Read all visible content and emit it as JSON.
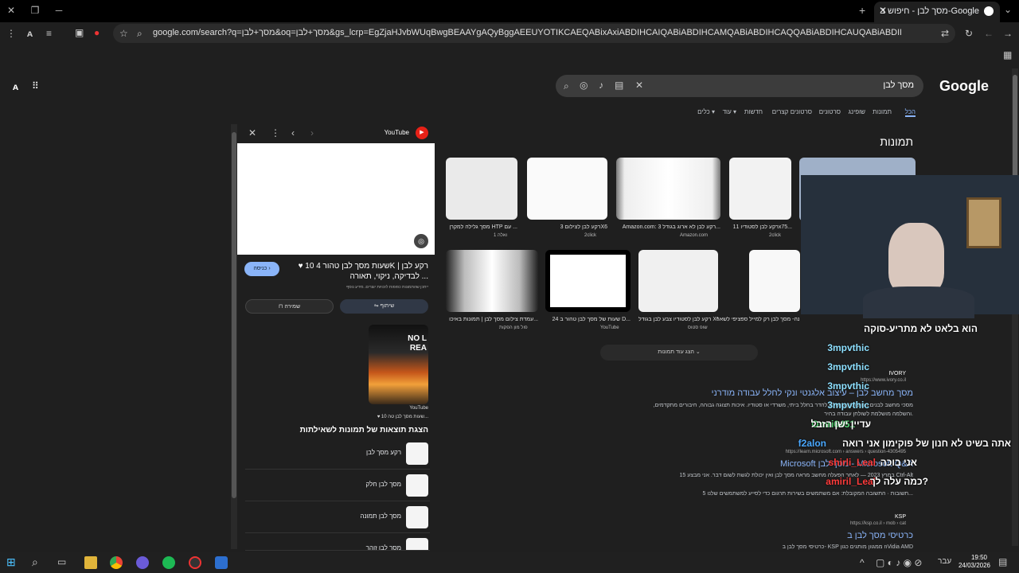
{
  "browser": {
    "tab_title": "מסך לבן - חיפוש ב-Google",
    "url": "google.com/search?q=מסך+לבן&oq=מסך+לבן&gs_lcrp=EgZjaHJvbWUqBwgBEAAYgAQyBggAEEUYOTIKCAEQABixAxiABDIHCAIQABiABDIHCAMQABiABDIHCAQQABiABDIHCAUQABiABDIHCAYQABiABDIHCAcQABiABDIHCAgQABiABDIHCAkQ..."
  },
  "search": {
    "logo": "Google",
    "query": "מסך לבן",
    "tabs": [
      "הכל",
      "תמונות",
      "שופינג",
      "סרטונים",
      "סרטונים קצרים",
      "חדשות",
      "עוד ▾",
      "כלים ▾"
    ]
  },
  "images": {
    "heading": "תמונות",
    "row1": [
      {
        "cap": "רקע לבן לסטודיו 11x75...",
        "src": "2click"
      },
      {
        "cap": "Amazon.com: רקע לבן לא ארוג בגודל 3...",
        "src": "Amazon.com"
      },
      {
        "cap": "רקע לבן לצילום 3X6",
        "src": "2click"
      },
      {
        "cap": "מסך גלילה למקרן HTP עם ...",
        "src": "1 ואלה"
      }
    ],
    "row2": [
      {
        "cap": "מסך חלילי לבן 217X200",
        "src": ""
      },
      {
        "cap": "בעיה תמונה- מסך לבן רק למייל ספציפי לשאר...",
        "src": ""
      },
      {
        "cap": "רקע לבן לסטודיו צבע לבן בגודל X6...",
        "src": "שופ סטוס"
      },
      {
        "cap": "24 שעות של מסך לבן טהור ב D...",
        "src": "YouTube"
      },
      {
        "cap": "עמדת צילום מסך לבן | תמונות באיכו...",
        "src": "פול מון הפקות"
      }
    ],
    "more": "הצג עוד תמונות"
  },
  "results": [
    {
      "site": "IVORY",
      "url": "https://www.ivory.co.il",
      "title": "מסך מחשב לבן – עיצוב אלגנטי ונקי לחלל עבודה מודרני",
      "snippet": "מסכי מחשב לבנים הם פתרון מושלם להדר בחלל ביתי, משרדי או סטודיו. איכות תצוגה גבוהה, חיבורים מתקדמים, והשלמה מושלמת לשולחן עבודה בהיר."
    },
    {
      "site": "Microsoft",
      "url": "https://learn.microsoft.com › answers › question-4305495",
      "title": "Microsoft מסך לבן - Microsoft Q&A",
      "snippet": "15 במרץ 2023 — לאחר הפעלה מחשב מראה מסך לבן ואין יכולת לגשת לשום דבר. אני מבצע Ctrl-Alt",
      "snippet2": "5 תשובות · התשובה המקובלת: אם משתמשים בשירות תרגום כדי לסייע למשתמשים שלנו..."
    },
    {
      "site": "KSP",
      "url": "https://ksp.co.il › mob › cat",
      "title": "כרטיסי מסך לבן ב",
      "snippet": "כרטיסי מסך לבן ב- KSP ממגוון מותגים כגון nVidia AMD"
    }
  ],
  "panel": {
    "source": "YouTube",
    "title": "♥ 10 שעות מסך לבן טהור 4K | רקע לבן לבדיקה, ניקוי, תאורה ...",
    "note": "ייתכן שהתמונות כפופות לזכויות יוצרים. מידע נוסף",
    "visit": "כניסה ›",
    "share": "שיתוף",
    "save": "שמירה",
    "thumb_src": "YouTube",
    "thumb_title": "♥ 10 שעות מסך לבן טה...",
    "thumb_text": "NO L REA",
    "related_heading": "הצגת תוצאות של תמונות לשאילתות",
    "related": [
      "רקע מסך לבן",
      "מסך לבן חלק",
      "מסך לבן תמונה",
      "מסך לבן זוהר"
    ]
  },
  "chat": [
    {
      "user": "",
      "msg": "הוא בלאט לא מתריע-סוקה"
    },
    {
      "user": "3mpvthic",
      "msg": ""
    },
    {
      "user": "3mpvthic",
      "msg": ""
    },
    {
      "user": "3mpvthic",
      "msg": ""
    },
    {
      "user": "3mpvthic",
      "msg": ""
    },
    {
      "user": "Omri6451",
      "msg": "עדיין ישן הזבל"
    },
    {
      "user": "f2alon",
      "msg": "אתה בשיט לא חנון של פוקימון אני רואה"
    },
    {
      "user": "shirli_Leal",
      "msg": "אני בוכה"
    },
    {
      "user": "amiril_Leal",
      "msg": "כמה עלה לך?"
    }
  ],
  "taskbar": {
    "lang": "עבר",
    "time": "19:50",
    "date": "24/03/2026"
  },
  "colors": {
    "accent": "#8ab4f8",
    "chat_name": "#8ee0ff",
    "chat_red": "#ff3b3b",
    "bg": "#1f1f1f"
  }
}
